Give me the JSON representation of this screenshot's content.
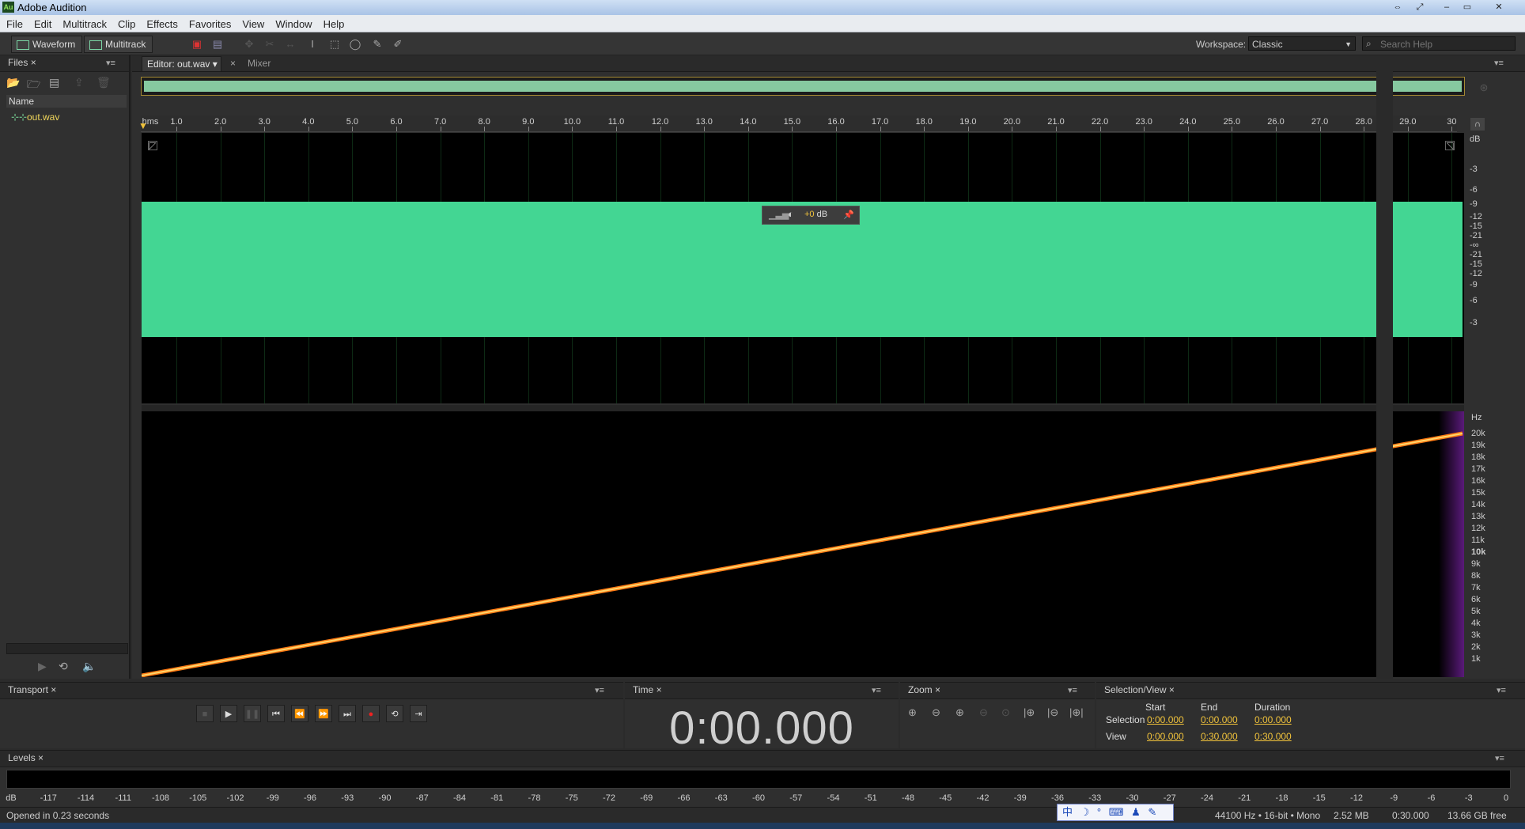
{
  "app": {
    "title": "Adobe Audition",
    "icon_text": "Au"
  },
  "window_controls": [
    "⇔",
    "⤢",
    "–",
    "▭",
    "✕"
  ],
  "menu": [
    "File",
    "Edit",
    "Multitrack",
    "Clip",
    "Effects",
    "Favorites",
    "View",
    "Window",
    "Help"
  ],
  "toolbar": {
    "waveform_label": "Waveform",
    "multitrack_label": "Multitrack",
    "workspace_label": "Workspace:",
    "workspace_value": "Classic",
    "search_placeholder": "Search Help"
  },
  "files_panel": {
    "tab": "Files",
    "column": "Name",
    "items": [
      {
        "name": "out.wav"
      }
    ]
  },
  "editor": {
    "tab": "Editor: out.wav",
    "mixer_tab": "Mixer",
    "ruler_unit": "hms",
    "ruler_ticks": [
      "1.0",
      "2.0",
      "3.0",
      "4.0",
      "5.0",
      "6.0",
      "7.0",
      "8.0",
      "9.0",
      "10.0",
      "11.0",
      "12.0",
      "13.0",
      "14.0",
      "15.0",
      "16.0",
      "17.0",
      "18.0",
      "19.0",
      "20.0",
      "21.0",
      "22.0",
      "23.0",
      "24.0",
      "25.0",
      "26.0",
      "27.0",
      "28.0",
      "29.0",
      "30"
    ],
    "hud_value": "+0",
    "hud_unit": "dB",
    "db_unit": "dB",
    "db_labels": [
      "-3",
      "-6",
      "-9",
      "-12",
      "-15",
      "-21",
      "-∞",
      "-21",
      "-15",
      "-12",
      "-9",
      "-6",
      "-3"
    ],
    "hz_unit": "Hz",
    "hz_labels": [
      "20k",
      "19k",
      "18k",
      "17k",
      "16k",
      "15k",
      "14k",
      "13k",
      "12k",
      "11k",
      "10k",
      "9k",
      "8k",
      "7k",
      "6k",
      "5k",
      "4k",
      "3k",
      "2k",
      "1k"
    ]
  },
  "transport": {
    "tab": "Transport"
  },
  "time": {
    "tab": "Time",
    "value": "0:00.000"
  },
  "zoom": {
    "tab": "Zoom"
  },
  "selection_view": {
    "tab": "Selection/View",
    "headers": [
      "Start",
      "End",
      "Duration"
    ],
    "selection_label": "Selection",
    "view_label": "View",
    "selection": [
      "0:00.000",
      "0:00.000",
      "0:00.000"
    ],
    "view": [
      "0:00.000",
      "0:30.000",
      "0:30.000"
    ]
  },
  "levels": {
    "tab": "Levels",
    "scale": [
      "dB",
      "-117",
      "-114",
      "-111",
      "-108",
      "-105",
      "-102",
      "-99",
      "-96",
      "-93",
      "-90",
      "-87",
      "-84",
      "-81",
      "-78",
      "-75",
      "-72",
      "-69",
      "-66",
      "-63",
      "-60",
      "-57",
      "-54",
      "-51",
      "-48",
      "-45",
      "-42",
      "-39",
      "-36",
      "-33",
      "-30",
      "-27",
      "-24",
      "-21",
      "-18",
      "-15",
      "-12",
      "-9",
      "-6",
      "-3",
      "0"
    ]
  },
  "status": {
    "message": "Opened in 0.23 seconds",
    "format": "44100 Hz • 16-bit • Mono",
    "size": "2.52 MB",
    "duration": "0:30.000",
    "free": "13.66 GB free"
  },
  "ime_bar": "中 ☽ ° ⌨ ♟ ✎",
  "colors": {
    "waveform": "#43d693",
    "accent": "#f0c23b",
    "spectral_line": "#ff8a1a"
  }
}
